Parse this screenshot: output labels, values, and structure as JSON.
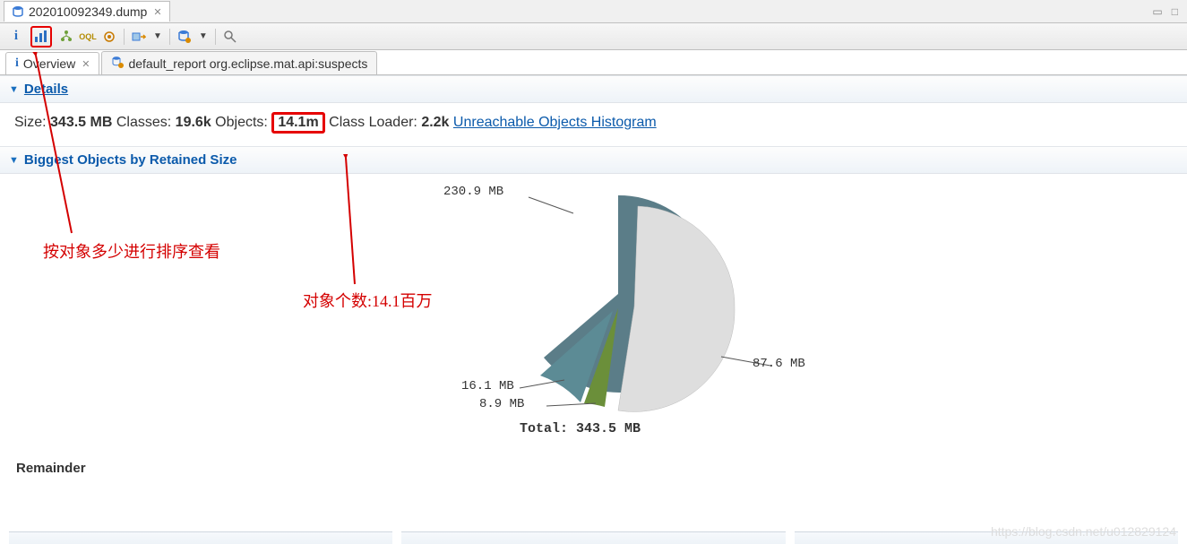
{
  "editor_tab": {
    "filename": "202010092349.dump"
  },
  "toolbar": {
    "icons": [
      "info",
      "histogram",
      "dominator-tree",
      "oql",
      "thread",
      "run",
      "dropdown1",
      "db",
      "dropdown2",
      "search"
    ]
  },
  "subtabs": {
    "overview": "Overview",
    "report": "default_report  org.eclipse.mat.api:suspects"
  },
  "sections": {
    "details": "Details",
    "biggest": "Biggest Objects by Retained Size"
  },
  "details": {
    "size_label": "Size:",
    "size_value": "343.5 MB",
    "classes_label": "Classes:",
    "classes_value": "19.6k",
    "objects_label": "Objects:",
    "objects_value": "14.1m",
    "loader_label": "Class Loader:",
    "loader_value": "2.2k",
    "histogram_link": "Unreachable Objects Histogram"
  },
  "annotations": {
    "sort_note": "按对象多少进行排序查看",
    "count_note": "对象个数:14.1百万"
  },
  "chart_data": {
    "type": "pie",
    "slices": [
      {
        "label": "230.9 MB",
        "value": 230.9,
        "color": "#5b7d88"
      },
      {
        "label": "87.6 MB",
        "value": 87.6,
        "color": "#dedede"
      },
      {
        "label": "8.9 MB",
        "value": 8.9,
        "color": "#6b8f3a"
      },
      {
        "label": "16.1 MB",
        "value": 16.1,
        "color": "#5c8b95"
      }
    ],
    "total": "Total: 343.5 MB"
  },
  "remainder": "Remainder",
  "watermark": "https://blog.csdn.net/u012829124"
}
